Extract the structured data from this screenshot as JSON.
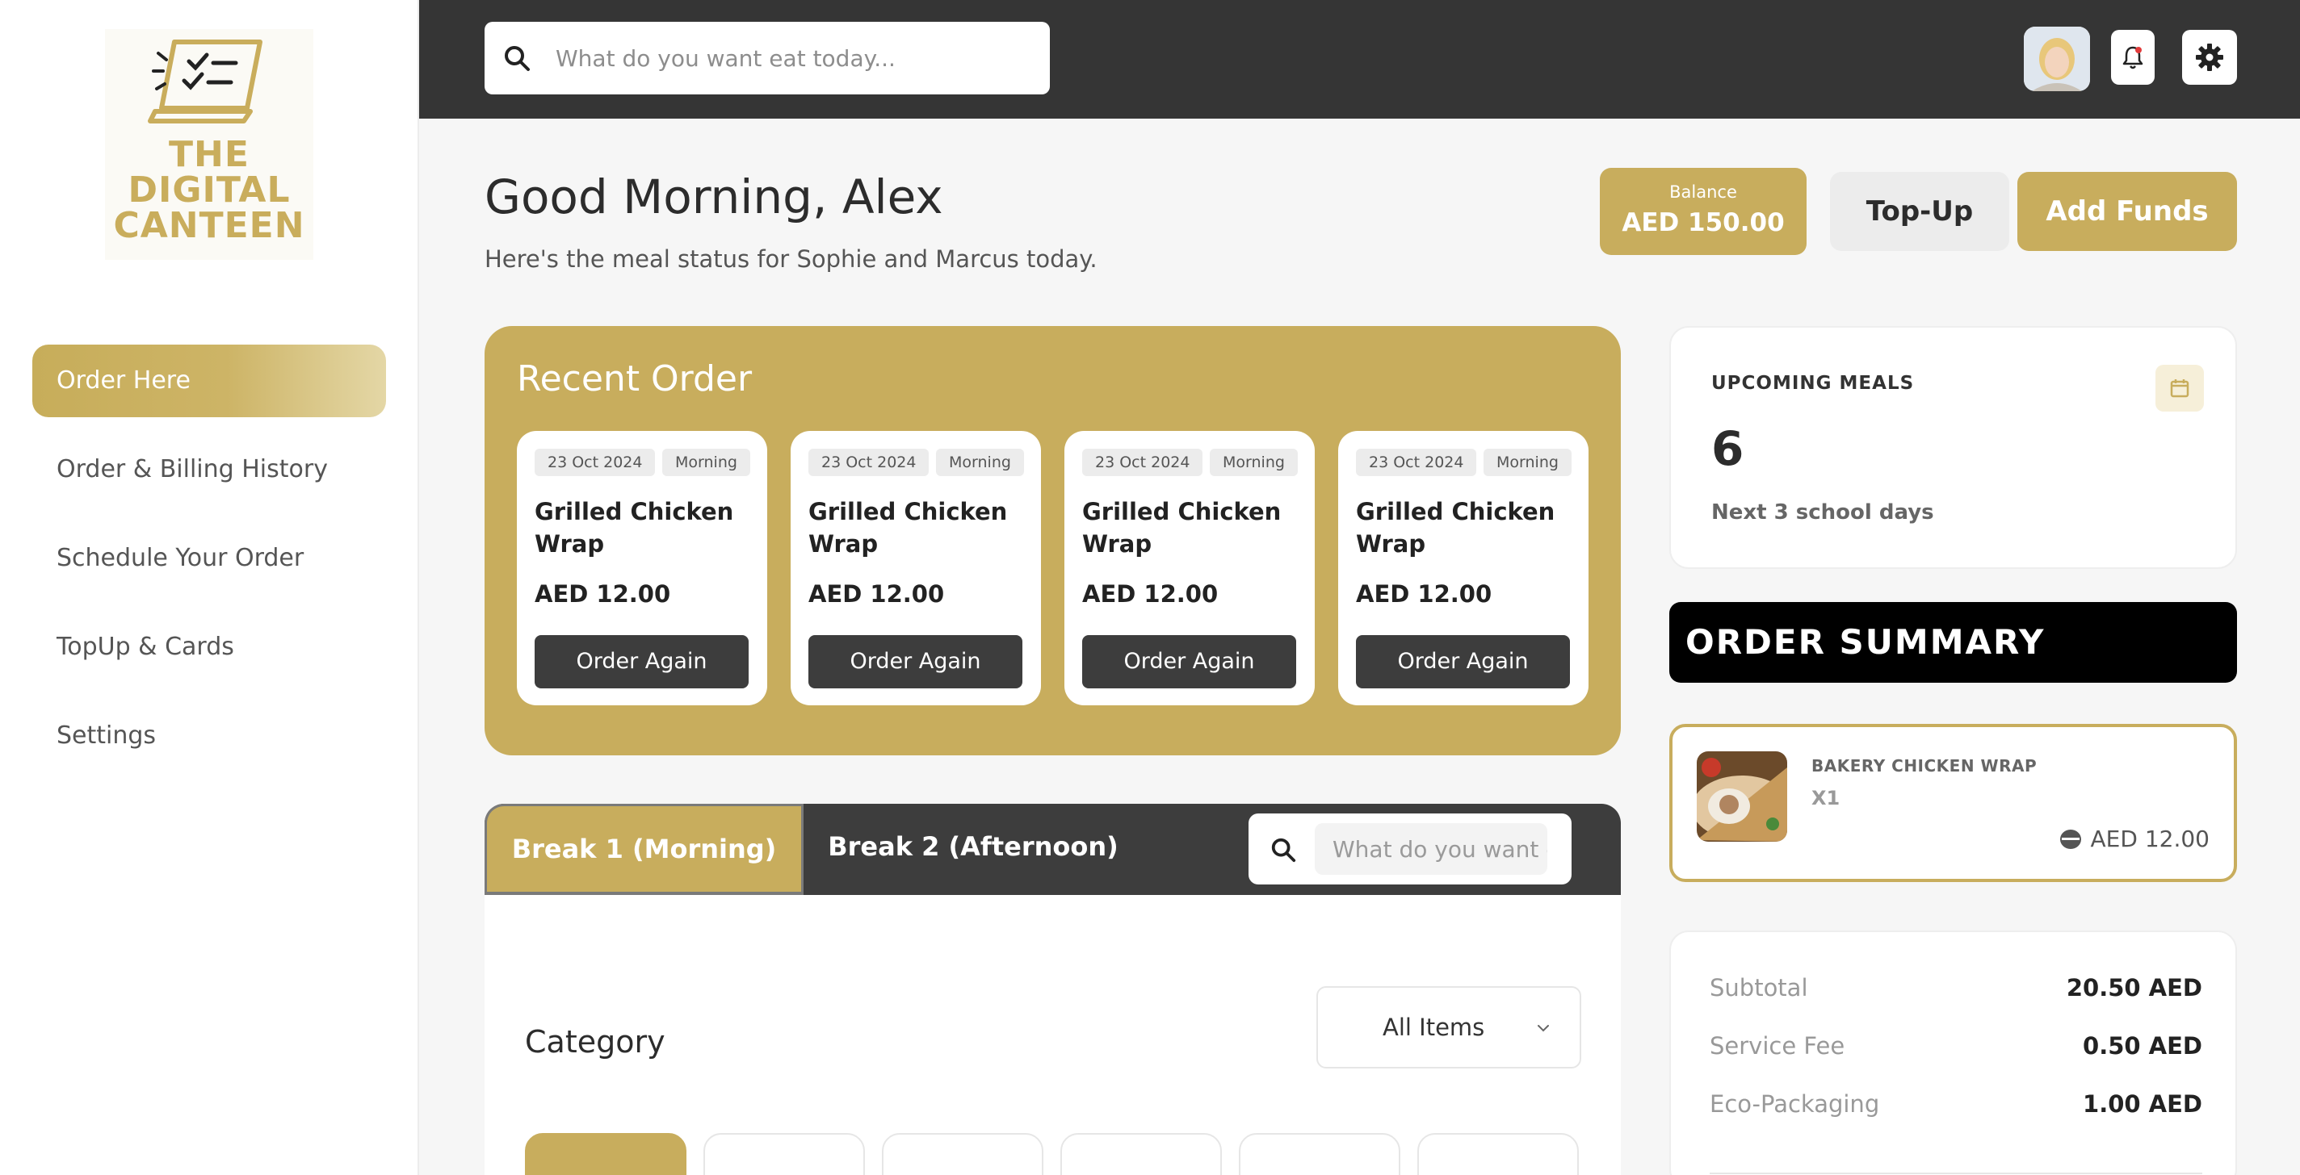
{
  "brand": {
    "logo_line1": "THE",
    "logo_line2": "DIGITAL",
    "logo_line3": "CANTEEN",
    "accent": "#c8ad5d",
    "dark": "#353535"
  },
  "sidebar": {
    "items": [
      {
        "label": "Order Here",
        "active": true
      },
      {
        "label": "Order & Billing History"
      },
      {
        "label": "Schedule Your Order"
      },
      {
        "label": "TopUp & Cards"
      },
      {
        "label": "Settings"
      }
    ]
  },
  "topbar": {
    "search_placeholder": "What do you want eat today...",
    "icons": [
      "search-icon",
      "avatar",
      "bell-icon",
      "gear-icon"
    ]
  },
  "header": {
    "greeting": "Good Morning, Alex",
    "subtitle": "Here's the meal status for Sophie and Marcus today.",
    "balance_label": "Balance",
    "balance_value": "AED 150.00",
    "topup_label": "Top-Up",
    "add_funds_label": "Add Funds"
  },
  "recent": {
    "title": "Recent Order",
    "orders": [
      {
        "date": "23 Oct 2024",
        "slot": "Morning",
        "name": "Grilled Chicken Wrap",
        "price": "AED 12.00",
        "button": "Order Again"
      },
      {
        "date": "23 Oct 2024",
        "slot": "Morning",
        "name": "Grilled Chicken Wrap",
        "price": "AED 12.00",
        "button": "Order Again"
      },
      {
        "date": "23 Oct 2024",
        "slot": "Morning",
        "name": "Grilled Chicken Wrap",
        "price": "AED 12.00",
        "button": "Order Again"
      },
      {
        "date": "23 Oct 2024",
        "slot": "Morning",
        "name": "Grilled Chicken Wrap",
        "price": "AED 12.00",
        "button": "Order Again"
      }
    ]
  },
  "breaks": {
    "tab1": "Break 1 (Morning)",
    "tab2": "Break 2 (Afternoon)",
    "search_placeholder": "What do you want eat today..."
  },
  "menu": {
    "category_title": "Category",
    "filter_selected": "All Items"
  },
  "upcoming": {
    "label": "UPCOMING MEALS",
    "count": "6",
    "subtitle": "Next 3 school days"
  },
  "summary": {
    "title": "ORDER SUMMARY",
    "item": {
      "name": "BAKERY CHICKEN WRAP",
      "qty": "X1",
      "price": "AED 12.00"
    },
    "rows": [
      {
        "label": "Subtotal",
        "value": "20.50 AED"
      },
      {
        "label": "Service Fee",
        "value": "0.50 AED"
      },
      {
        "label": "Eco-Packaging",
        "value": "1.00 AED"
      }
    ]
  }
}
